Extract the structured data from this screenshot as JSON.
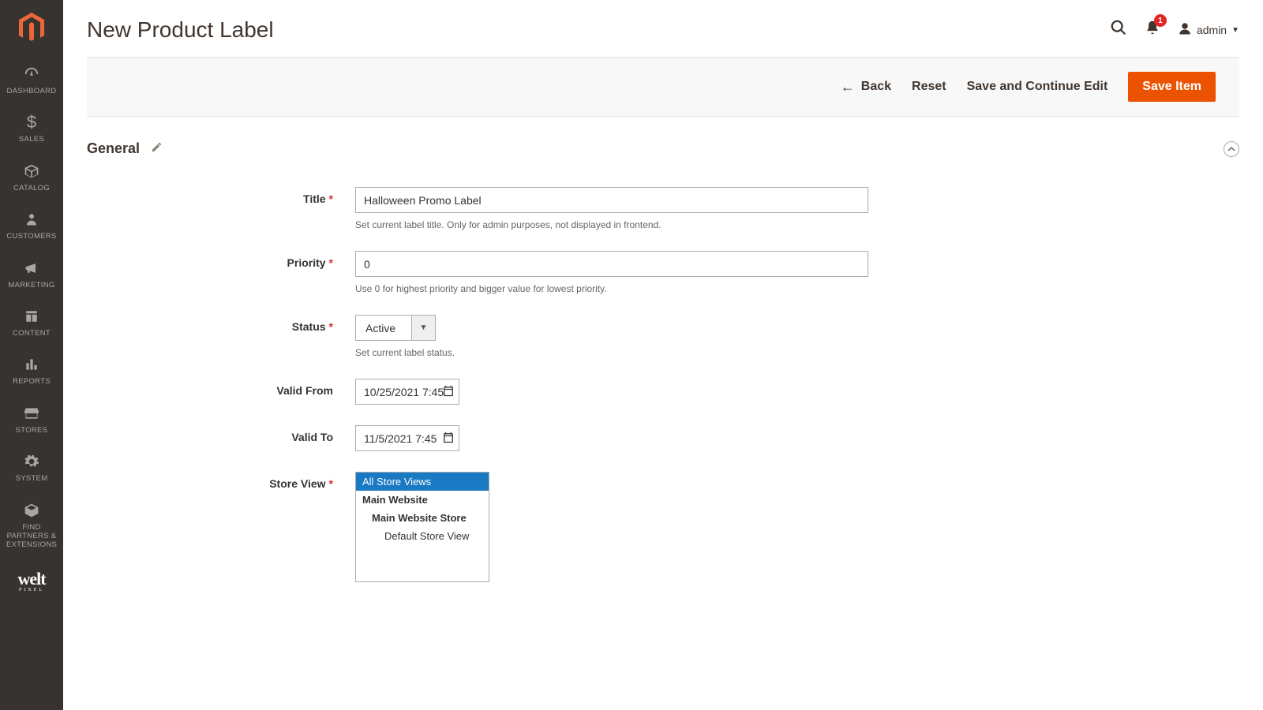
{
  "header": {
    "title": "New Product Label",
    "notif_count": "1",
    "user_name": "admin"
  },
  "sidebar": {
    "items": [
      {
        "label": "DASHBOARD"
      },
      {
        "label": "SALES"
      },
      {
        "label": "CATALOG"
      },
      {
        "label": "CUSTOMERS"
      },
      {
        "label": "MARKETING"
      },
      {
        "label": "CONTENT"
      },
      {
        "label": "REPORTS"
      },
      {
        "label": "STORES"
      },
      {
        "label": "SYSTEM"
      },
      {
        "label": "FIND PARTNERS & EXTENSIONS"
      }
    ],
    "welt": "welt",
    "welt_sub": "PIXEL"
  },
  "actions": {
    "back": "Back",
    "reset": "Reset",
    "save_continue": "Save and Continue Edit",
    "save": "Save Item"
  },
  "section": {
    "title": "General"
  },
  "form": {
    "title_label": "Title",
    "title_value": "Halloween Promo Label",
    "title_help": "Set current label title. Only for admin purposes, not displayed in frontend.",
    "priority_label": "Priority",
    "priority_value": "0",
    "priority_help": "Use 0 for highest priority and bigger value for lowest priority.",
    "status_label": "Status",
    "status_value": "Active",
    "status_help": "Set current label status.",
    "valid_from_label": "Valid From",
    "valid_from_value": "10/25/2021 7:45",
    "valid_to_label": "Valid To",
    "valid_to_value": "11/5/2021 7:45 ",
    "store_view_label": "Store View",
    "store_view": {
      "all": "All Store Views",
      "main_website": "Main Website",
      "main_website_store": "Main Website Store",
      "default_store_view": "Default Store View"
    }
  }
}
